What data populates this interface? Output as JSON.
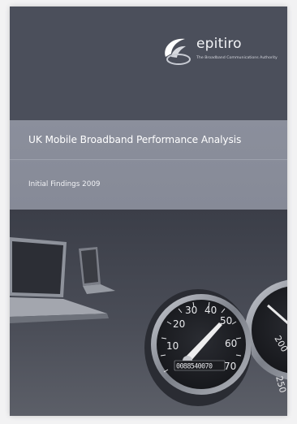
{
  "brand": {
    "name": "epitiro",
    "tagline": "The Broadband Communications Authority"
  },
  "title": "UK Mobile Broadband Performance Analysis",
  "subtitle": "Initial Findings 2009",
  "gauge": {
    "ticks": [
      "10",
      "20",
      "30",
      "40",
      "50",
      "60",
      "70"
    ],
    "odometer": "0088540070"
  },
  "colors": {
    "panel": "#4b4f5b",
    "band": "#8b8f9c",
    "text": "#ffffff"
  }
}
